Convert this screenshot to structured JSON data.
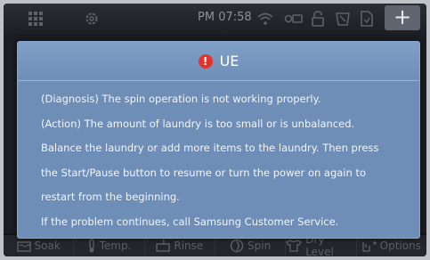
{
  "status_bar": {
    "time": "PM 07:58",
    "icons": [
      "grid-icon",
      "gear-icon",
      "wifi-icon",
      "smart-control-icon",
      "door-lock-icon",
      "tub-clean-icon",
      "document-icon"
    ],
    "add_label": "+"
  },
  "dialog": {
    "title": "UE",
    "alert_icon": "!",
    "lines": [
      "(Diagnosis) The spin operation is not working properly.",
      "(Action) The amount of laundry is too small or is unbalanced.",
      "Balance the laundry or add more items to the laundry. Then press",
      "the Start/Pause button to resume or turn the power on again to",
      "restart from the beginning.",
      "If the problem continues, call Samsung Customer Service."
    ]
  },
  "bottom_nav": {
    "items": [
      {
        "label": "Soak",
        "icon": "soak-icon"
      },
      {
        "label": "Temp.",
        "icon": "thermometer-icon"
      },
      {
        "label": "Rinse",
        "icon": "rinse-icon"
      },
      {
        "label": "Spin",
        "icon": "spin-icon"
      },
      {
        "label": "Dry Level",
        "icon": "shirt-icon"
      },
      {
        "label": "Options",
        "icon": "options-icon"
      }
    ]
  },
  "colors": {
    "dialog_bg": "#6e8eb7",
    "alert_red": "#e4322c",
    "screen_bg": "#121417"
  }
}
